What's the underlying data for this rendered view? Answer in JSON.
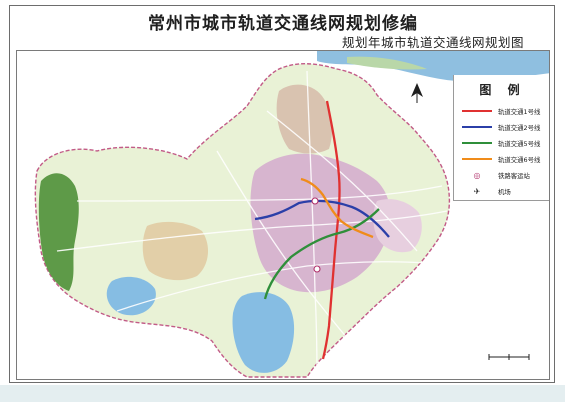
{
  "title": "常州市城市轨道交通线网规划修编",
  "subtitle": "规划年城市轨道交通线网规划图",
  "legend": {
    "title": "图 例",
    "items": [
      {
        "label": "轨道交通1号线",
        "color": "#e03131",
        "symbol": "line"
      },
      {
        "label": "轨道交通2号线",
        "color": "#2b3fa8",
        "symbol": "line"
      },
      {
        "label": "轨道交通5号线",
        "color": "#2f8f3a",
        "symbol": "line"
      },
      {
        "label": "轨道交通6号线",
        "color": "#f08c1a",
        "symbol": "line"
      },
      {
        "label": "铁路客运站",
        "color": "#b0306a",
        "symbol": "rail-station-icon"
      },
      {
        "label": "机场",
        "color": "#222222",
        "symbol": "airport-icon"
      }
    ]
  },
  "colors": {
    "river": "#7fb2d9",
    "lake": "#8cc0e2",
    "urban": "#c9a9c4",
    "green": "#9ec95c",
    "forest": "#4f8a3e",
    "roads": "#ffffff"
  }
}
